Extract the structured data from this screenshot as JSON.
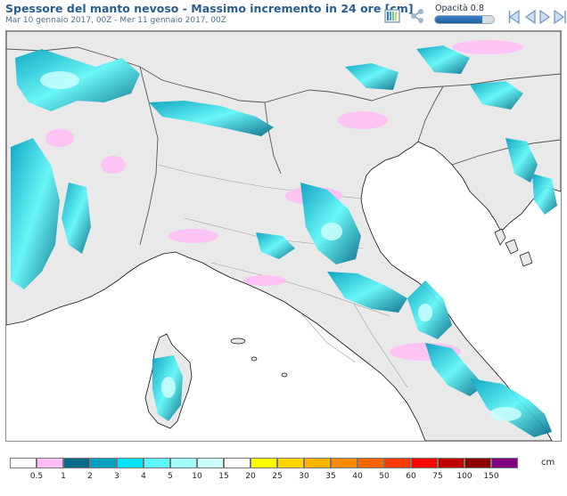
{
  "header": {
    "title": "Spessore del manto nevoso - Massimo incremento in 24 ore [cm]",
    "subtitle": "Mar 10 gennaio 2017, 00Z - Mer 11 gennaio 2017, 00Z"
  },
  "toolbar": {
    "opacity_label": "Opacità 0.8",
    "opacity_value": 0.8,
    "buttons": [
      "legend-icon",
      "share-icon",
      "first-frame-icon",
      "previous-frame-icon",
      "next-frame-icon",
      "last-frame-icon"
    ]
  },
  "map": {
    "region": "Northern and central Italy",
    "colors": {
      "land": "#e9e9ea",
      "sea": "#ffffff",
      "border": "#555555",
      "coast": "#000000"
    }
  },
  "legend": {
    "unit": "cm",
    "labels": [
      "0.5",
      "1",
      "2",
      "3",
      "4",
      "5",
      "10",
      "15",
      "20",
      "25",
      "30",
      "35",
      "40",
      "50",
      "60",
      "75",
      "100",
      "150"
    ],
    "colors": [
      "#ffffff",
      "#ffbff5",
      "#006a87",
      "#00a2c0",
      "#00e4fb",
      "#5ff8f9",
      "#a1fcfc",
      "#cbfdfc",
      "#ffffff",
      "#ffff00",
      "#ffd500",
      "#ffb300",
      "#ff8c00",
      "#ff6600",
      "#ff3a00",
      "#ff0000",
      "#c00000",
      "#8b0000",
      "#800080"
    ]
  }
}
